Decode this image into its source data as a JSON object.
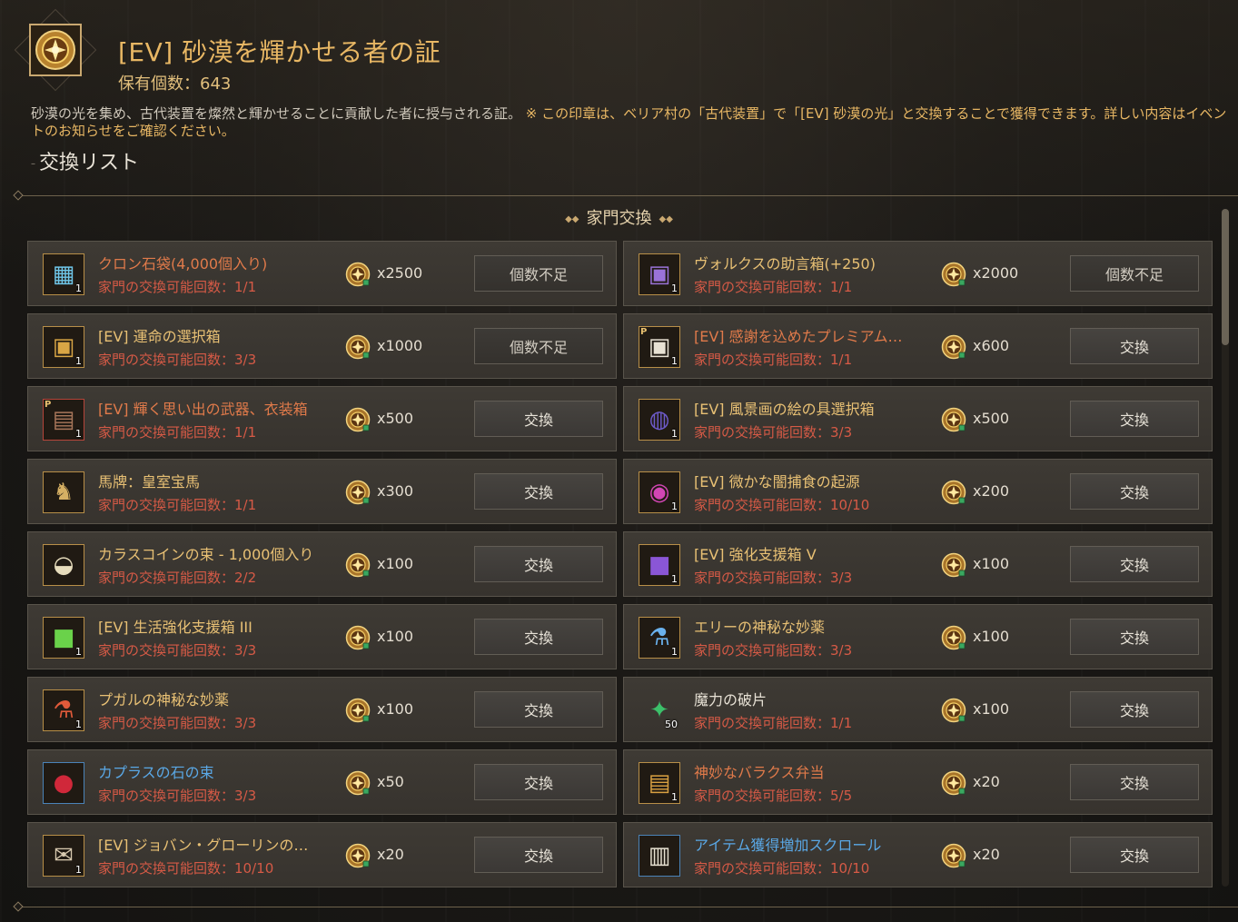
{
  "header": {
    "title": "[EV] 砂漠を輝かせる者の証",
    "owned_label": "保有個数：",
    "owned_value": "643",
    "description": "砂漠の光を集め、古代装置を燦然と輝かせることに貢献した者に授与される証。",
    "description_note": "※ この印章は、ベリア村の「古代装置」で「[EV] 砂漠の光」と交換することで獲得できます。詳しい内容はイベントのお知らせをご確認ください。",
    "section_title": "交換リスト"
  },
  "group": {
    "title": "家門交換"
  },
  "limit_label": "家門の交換可能回数：",
  "items": [
    {
      "name": "クロン石袋(4,000個入り)",
      "name_color": "orange",
      "limit": "1/1",
      "cost": "x2500",
      "button": "個数不足",
      "disabled": true,
      "icon": "chest-blue-icon",
      "glyph": "▦",
      "glyph_color": "#6fc6e8",
      "qty": "1",
      "badge": "",
      "border": "gold"
    },
    {
      "name": "ヴォルクスの助言箱(+250)",
      "name_color": "gold",
      "limit": "1/1",
      "cost": "x2000",
      "button": "個数不足",
      "disabled": true,
      "icon": "chest-purple-icon",
      "glyph": "▣",
      "glyph_color": "#9a72d8",
      "qty": "1",
      "badge": "",
      "border": "gold"
    },
    {
      "name": "[EV] 運命の選択箱",
      "name_color": "gold",
      "limit": "3/3",
      "cost": "x1000",
      "button": "個数不足",
      "disabled": true,
      "icon": "chest-gold-icon",
      "glyph": "▣",
      "glyph_color": "#d9a645",
      "qty": "1",
      "badge": "",
      "border": "gold"
    },
    {
      "name": "[EV] 感謝を込めたプレミアム…",
      "name_color": "orange",
      "limit": "1/1",
      "cost": "x600",
      "button": "交換",
      "disabled": false,
      "icon": "chest-white-icon",
      "glyph": "▣",
      "glyph_color": "#e8e2d4",
      "qty": "1",
      "badge": "P",
      "border": "gold"
    },
    {
      "name": "[EV] 輝く思い出の武器、衣装箱",
      "name_color": "orange",
      "limit": "1/1",
      "cost": "x500",
      "button": "交換",
      "disabled": false,
      "icon": "chest-wood-icon",
      "glyph": "▤",
      "glyph_color": "#a8765a",
      "qty": "1",
      "badge": "P",
      "border": "red"
    },
    {
      "name": "[EV] 風景画の絵の具選択箱",
      "name_color": "gold",
      "limit": "3/3",
      "cost": "x500",
      "button": "交換",
      "disabled": false,
      "icon": "paint-box-icon",
      "glyph": "◍",
      "glyph_color": "#6c5ac8",
      "qty": "1",
      "badge": "",
      "border": "gold"
    },
    {
      "name": "馬牌：皇室宝馬",
      "name_color": "gold",
      "limit": "1/1",
      "cost": "x300",
      "button": "交換",
      "disabled": false,
      "icon": "horse-medal-icon",
      "glyph": "♞",
      "glyph_color": "#d6b064",
      "qty": "",
      "badge": "",
      "border": "gold"
    },
    {
      "name": "[EV] 微かな闇捕食の起源",
      "name_color": "gold",
      "limit": "10/10",
      "cost": "x200",
      "button": "交換",
      "disabled": false,
      "icon": "dark-swirl-icon",
      "glyph": "◉",
      "glyph_color": "#d246b4",
      "qty": "1",
      "badge": "",
      "border": "gold"
    },
    {
      "name": "カラスコインの束 - 1,000個入り",
      "name_color": "gold",
      "limit": "2/2",
      "cost": "x100",
      "button": "交換",
      "disabled": false,
      "icon": "coin-pouch-icon",
      "glyph": "◒",
      "glyph_color": "#e6dcbc",
      "qty": "",
      "badge": "",
      "border": "gold"
    },
    {
      "name": "[EV] 強化支援箱 V",
      "name_color": "gold",
      "limit": "3/3",
      "cost": "x100",
      "button": "交換",
      "disabled": false,
      "icon": "support-box-purple-icon",
      "glyph": "■",
      "glyph_color": "#8a56d6",
      "qty": "1",
      "badge": "",
      "border": "gold"
    },
    {
      "name": "[EV] 生活強化支援箱 III",
      "name_color": "gold",
      "limit": "3/3",
      "cost": "x100",
      "button": "交換",
      "disabled": false,
      "icon": "support-box-green-icon",
      "glyph": "■",
      "glyph_color": "#6ad24a",
      "qty": "1",
      "badge": "",
      "border": "gold"
    },
    {
      "name": "エリーの神秘な妙薬",
      "name_color": "gold",
      "limit": "3/3",
      "cost": "x100",
      "button": "交換",
      "disabled": false,
      "icon": "blue-potion-icon",
      "glyph": "⚗",
      "glyph_color": "#6ab2ee",
      "qty": "1",
      "badge": "",
      "border": "gold"
    },
    {
      "name": "プガルの神秘な妙薬",
      "name_color": "gold",
      "limit": "3/3",
      "cost": "x100",
      "button": "交換",
      "disabled": false,
      "icon": "red-potion-icon",
      "glyph": "⚗",
      "glyph_color": "#e05a3a",
      "qty": "1",
      "badge": "",
      "border": "gold"
    },
    {
      "name": "魔力の破片",
      "name_color": "white",
      "limit": "1/1",
      "cost": "x100",
      "button": "交換",
      "disabled": false,
      "icon": "magic-shard-icon",
      "glyph": "✦",
      "glyph_color": "#3cc06a",
      "qty": "50",
      "badge": "",
      "border": "none"
    },
    {
      "name": "カプラスの石の束",
      "name_color": "blue",
      "limit": "3/3",
      "cost": "x50",
      "button": "交換",
      "disabled": false,
      "icon": "caphras-stone-icon",
      "glyph": "●",
      "glyph_color": "#d0283a",
      "qty": "",
      "badge": "",
      "border": "blue"
    },
    {
      "name": "神妙なバラクス弁当",
      "name_color": "orange",
      "limit": "5/5",
      "cost": "x20",
      "button": "交換",
      "disabled": false,
      "icon": "lunchbox-icon",
      "glyph": "▤",
      "glyph_color": "#d8a042",
      "qty": "1",
      "badge": "",
      "border": "gold"
    },
    {
      "name": "[EV] ジョバン・グローリンの…",
      "name_color": "gold",
      "limit": "10/10",
      "cost": "x20",
      "button": "交換",
      "disabled": false,
      "icon": "letter-icon",
      "glyph": "✉",
      "glyph_color": "#d8cab0",
      "qty": "1",
      "badge": "",
      "border": "gold"
    },
    {
      "name": "アイテム獲得増加スクロール",
      "name_color": "blue",
      "limit": "10/10",
      "cost": "x20",
      "button": "交換",
      "disabled": false,
      "icon": "scroll-icon",
      "glyph": "▥",
      "glyph_color": "#e6e0d0",
      "qty": "",
      "badge": "",
      "border": "blue"
    }
  ]
}
